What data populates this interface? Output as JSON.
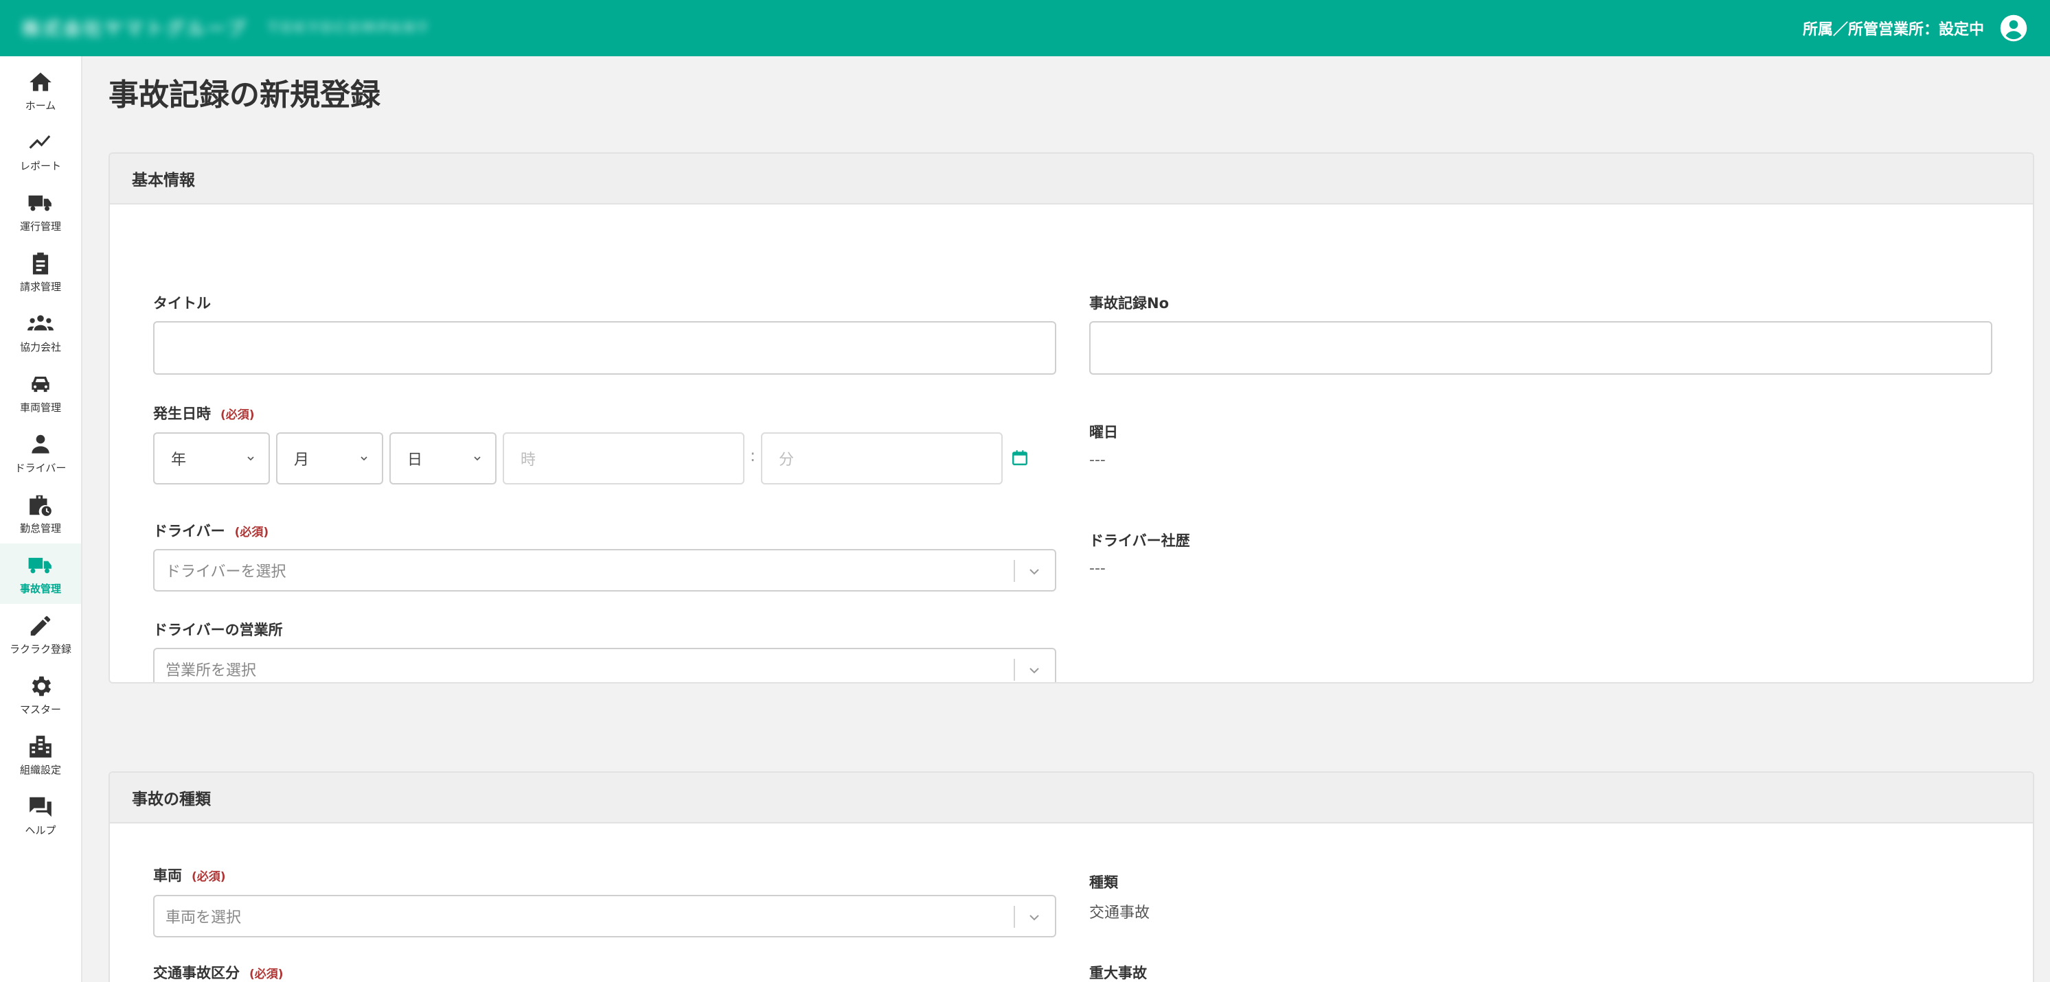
{
  "header": {
    "brand_name": "株式会社ヤマトグループ",
    "brand_sub": "TOKYOCOMPANY",
    "affiliation": "所属／所管営業所：設定中",
    "user_icon": "user-circle-icon",
    "color": "#00ab92"
  },
  "sidebar": {
    "items": [
      {
        "label": "ホーム",
        "icon": "home-icon"
      },
      {
        "label": "レポート",
        "icon": "trend-chart-icon"
      },
      {
        "label": "運行管理",
        "icon": "truck-icon"
      },
      {
        "label": "請求管理",
        "icon": "clipboard-icon"
      },
      {
        "label": "協力会社",
        "icon": "group-icon"
      },
      {
        "label": "車両管理",
        "icon": "car-icon"
      },
      {
        "label": "ドライバー",
        "icon": "person-icon"
      },
      {
        "label": "勤怠管理",
        "icon": "briefcase-clock-icon"
      },
      {
        "label": "事故管理",
        "icon": "truck-alert-icon",
        "active": true
      },
      {
        "label": "ラクラク登録",
        "icon": "pencil-icon"
      },
      {
        "label": "マスター",
        "icon": "gear-icon"
      },
      {
        "label": "組織設定",
        "icon": "building-icon"
      },
      {
        "label": "ヘルプ",
        "icon": "chat-icon"
      }
    ]
  },
  "page": {
    "title": "事故記録の新規登録"
  },
  "basic": {
    "heading": "基本情報",
    "title_label": "タイトル",
    "title_value": "",
    "record_no_label": "事故記録No",
    "record_no_value": "",
    "datetime_label": "発生日時",
    "required": "(必須)",
    "year": "年",
    "month": "月",
    "day": "日",
    "hour_placeholder": "時",
    "minute_placeholder": "分",
    "colon": ":",
    "weekday_label": "曜日",
    "weekday_value": "---",
    "driver_label": "ドライバー",
    "driver_placeholder": "ドライバーを選択",
    "career_label": "ドライバー社歴",
    "career_value": "---",
    "office_label": "ドライバーの営業所",
    "office_placeholder": "営業所を選択"
  },
  "type": {
    "heading": "事故の種類",
    "vehicle_label": "車両",
    "required": "(必須)",
    "vehicle_placeholder": "車両を選択",
    "kind_label": "種類",
    "kind_value": "交通事故",
    "category_label": "交通事故区分",
    "serious_label": "重大事故"
  }
}
